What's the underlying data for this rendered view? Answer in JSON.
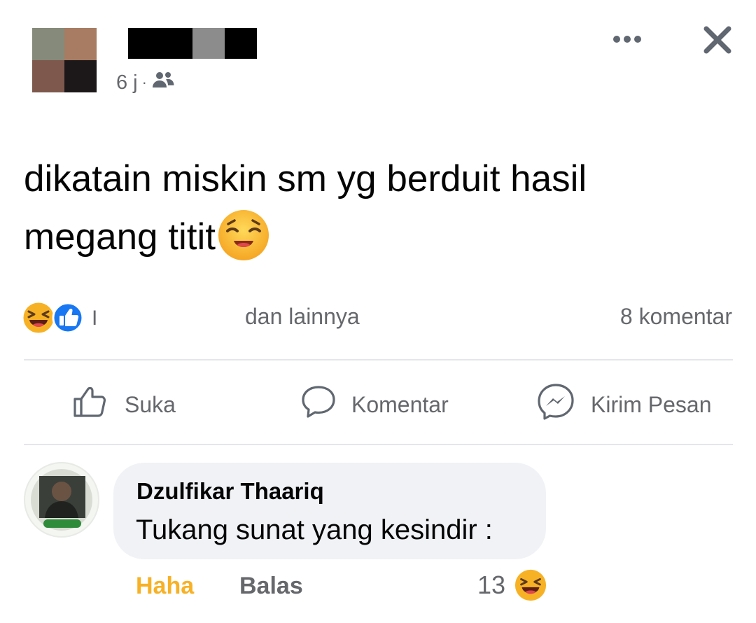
{
  "post": {
    "time": "6 j",
    "separator": "·",
    "audience_icon": "friends-icon",
    "text_line1": "dikatain miskin sm yg berduit hasil",
    "text_line2": "megang titit",
    "text_emoji": "relieved-face-emoji"
  },
  "header": {
    "more_icon": "more-options-icon",
    "close_icon": "close-icon"
  },
  "reactions": {
    "icons": [
      "haha-reaction-icon",
      "like-reaction-icon"
    ],
    "cut_text": "I",
    "others_text": "dan lainnya",
    "comments_text": "8 komentar"
  },
  "actions": {
    "like_label": "Suka",
    "comment_label": "Komentar",
    "send_label": "Kirim Pesan"
  },
  "comment": {
    "author": "Dzulfikar Thaariq",
    "text": "Tukang sunat yang kesindir :",
    "haha_label": "Haha",
    "reply_label": "Balas",
    "reaction_count": "13",
    "reaction_icon": "haha-reaction-icon"
  },
  "colors": {
    "secondary_text": "#65676b",
    "haha_yellow": "#f7b125",
    "like_blue": "#1877f2",
    "bubble_bg": "#f0f2f5",
    "divider": "#e4e6eb"
  }
}
